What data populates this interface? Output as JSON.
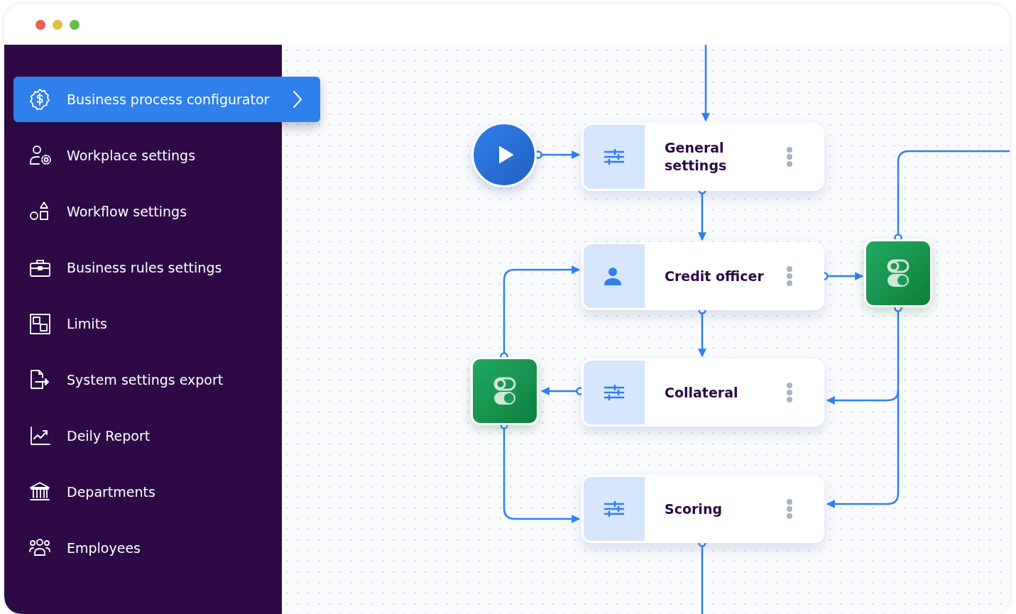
{
  "window": {
    "controls": [
      {
        "color": "#ec5f57"
      },
      {
        "color": "#e2bf3e"
      },
      {
        "color": "#62c04a"
      }
    ]
  },
  "sidebar": {
    "items": [
      {
        "label": "Business process configurator",
        "selected": true
      },
      {
        "label": "Workplace settings",
        "selected": false
      },
      {
        "label": "Workflow settings",
        "selected": false
      },
      {
        "label": "Business rules settings",
        "selected": false
      },
      {
        "label": "Limits",
        "selected": false
      },
      {
        "label": "System settings export",
        "selected": false
      },
      {
        "label": "Deily Report",
        "selected": false
      },
      {
        "label": "Departments",
        "selected": false
      },
      {
        "label": "Employees",
        "selected": false
      }
    ]
  },
  "diagram": {
    "nodes": [
      {
        "kind": "start"
      },
      {
        "kind": "settings",
        "label": "General settings"
      },
      {
        "kind": "person",
        "label": "Credit officer"
      },
      {
        "kind": "decision"
      },
      {
        "kind": "decision"
      },
      {
        "kind": "settings",
        "label": "Collateral"
      },
      {
        "kind": "settings",
        "label": "Scoring"
      }
    ]
  }
}
